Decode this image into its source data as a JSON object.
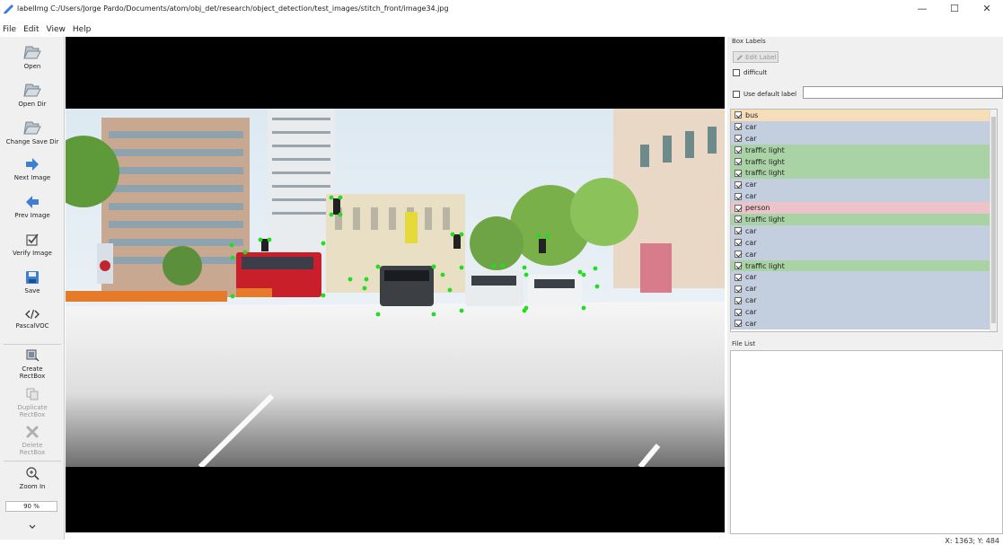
{
  "window": {
    "title": "labelImg C:/Users/Jorge Pardo/Documents/atom/obj_det/research/object_detection/test_images/stitch_front/image34.jpg",
    "minimize": "—",
    "maximize": "☐",
    "close": "✕"
  },
  "menu": [
    "File",
    "Edit",
    "View",
    "Help"
  ],
  "toolbar": {
    "open": "Open",
    "open_dir": "Open Dir",
    "change_save_dir": "Change Save Dir",
    "next_image": "Next Image",
    "prev_image": "Prev Image",
    "verify_image": "Verify Image",
    "save": "Save",
    "format": "PascalVOC",
    "create_rectbox": "Create\nRectBox",
    "duplicate_rectbox": "Duplicate\nRectBox",
    "delete_rectbox": "Delete\nRectBox",
    "zoom_in": "Zoom In",
    "zoom_value": "90 %"
  },
  "box_labels": {
    "title": "Box Labels",
    "edit_label": "Edit Label",
    "difficult": "difficult",
    "use_default_label": "Use default label",
    "default_label_value": "",
    "items": [
      {
        "text": "bus",
        "color": "#f6dfb8",
        "checked": true
      },
      {
        "text": "car",
        "color": "#c3cfdf",
        "checked": true
      },
      {
        "text": "car",
        "color": "#c3cfdf",
        "checked": true
      },
      {
        "text": "traffic light",
        "color": "#a9d3a5",
        "checked": true
      },
      {
        "text": "traffic light",
        "color": "#a9d3a5",
        "checked": true
      },
      {
        "text": "traffic light",
        "color": "#a9d3a5",
        "checked": true
      },
      {
        "text": "car",
        "color": "#c3cfdf",
        "checked": true
      },
      {
        "text": "car",
        "color": "#c3cfdf",
        "checked": true
      },
      {
        "text": "person",
        "color": "#ebc3c8",
        "checked": true
      },
      {
        "text": "traffic light",
        "color": "#a9d3a5",
        "checked": true
      },
      {
        "text": "car",
        "color": "#c3cfdf",
        "checked": true
      },
      {
        "text": "car",
        "color": "#c3cfdf",
        "checked": true
      },
      {
        "text": "car",
        "color": "#c3cfdf",
        "checked": true
      },
      {
        "text": "traffic light",
        "color": "#a9d3a5",
        "checked": true
      },
      {
        "text": "car",
        "color": "#c3cfdf",
        "checked": true
      },
      {
        "text": "car",
        "color": "#c3cfdf",
        "checked": true
      },
      {
        "text": "car",
        "color": "#c3cfdf",
        "checked": true
      },
      {
        "text": "car",
        "color": "#c3cfdf",
        "checked": true
      },
      {
        "text": "car",
        "color": "#c3cfdf",
        "checked": true
      }
    ]
  },
  "file_list": {
    "title": "File List"
  },
  "status": {
    "coords": "X: 1363; Y: 484"
  },
  "colors": {
    "annotation_point": "#22dd22",
    "canvas_bg": "#000000"
  }
}
